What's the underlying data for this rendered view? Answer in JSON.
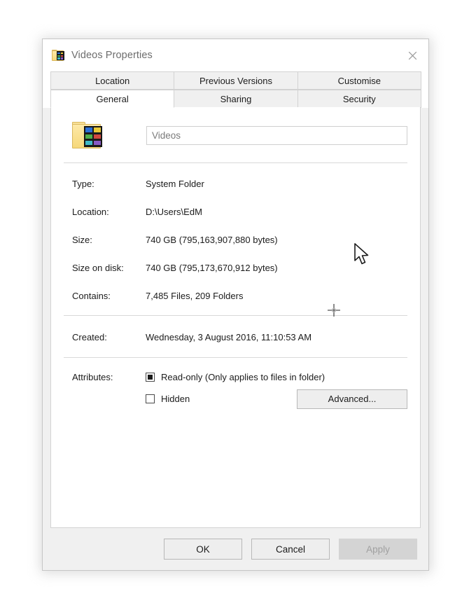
{
  "window": {
    "title": "Videos Properties",
    "icon": "videos-folder-icon",
    "close_label": "✕"
  },
  "tabs": {
    "top_row": [
      {
        "label": "Location",
        "active": false
      },
      {
        "label": "Previous Versions",
        "active": false
      },
      {
        "label": "Customise",
        "active": false
      }
    ],
    "bottom_row": [
      {
        "label": "General",
        "active": true
      },
      {
        "label": "Sharing",
        "active": false
      },
      {
        "label": "Security",
        "active": false
      }
    ]
  },
  "general": {
    "folder_icon": "videos-folder-icon",
    "name_value": "Videos",
    "properties": [
      {
        "label": "Type:",
        "value": "System Folder"
      },
      {
        "label": "Location:",
        "value": "D:\\Users\\EdM"
      },
      {
        "label": "Size:",
        "value": "740 GB (795,163,907,880 bytes)"
      },
      {
        "label": "Size on disk:",
        "value": "740 GB (795,173,670,912 bytes)"
      },
      {
        "label": "Contains:",
        "value": "7,485 Files, 209 Folders"
      }
    ],
    "created": {
      "label": "Created:",
      "value": "Wednesday, 3 August 2016, 11:10:53 AM"
    },
    "attributes": {
      "label": "Attributes:",
      "readonly": {
        "label": "Read-only (Only applies to files in folder)",
        "state": "indeterminate"
      },
      "hidden": {
        "label": "Hidden",
        "state": "unchecked"
      },
      "advanced_button": "Advanced..."
    }
  },
  "footer": {
    "ok": "OK",
    "cancel": "Cancel",
    "apply": "Apply",
    "apply_enabled": false
  },
  "colors": {
    "dialog_bg": "#f0f0f0",
    "panel_bg": "#ffffff",
    "border": "#d2d2d2",
    "text": "#1b1b1b",
    "muted_text": "#6d6d6d",
    "folder_yellow": "#f6d87a",
    "disabled_bg": "#d4d4d4"
  }
}
